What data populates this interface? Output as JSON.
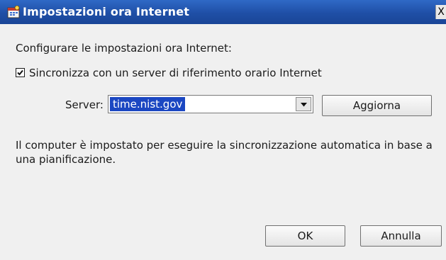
{
  "window": {
    "title": "Impostazioni ora Internet",
    "close_glyph": "X"
  },
  "dialog": {
    "prompt": "Configurare le impostazioni ora Internet:",
    "sync_checkbox": {
      "label": "Sincronizza con un server di riferimento orario Internet",
      "checked": true
    },
    "server_label": "Server:",
    "server_value": "time.nist.gov",
    "update_button": "Aggiorna",
    "info_text": "Il computer è impostato per eseguire la sincronizzazione automatica in base a una pianificazione.",
    "ok_button": "OK",
    "cancel_button": "Annulla"
  },
  "icons": {
    "title_icon": "date-time-icon",
    "combo_arrow": "chevron-down-icon",
    "checkmark": "checkmark-icon"
  },
  "colors": {
    "titlebar": "#1f4fa6",
    "selection": "#1b47c2",
    "client_bg": "#f0f0f0"
  }
}
